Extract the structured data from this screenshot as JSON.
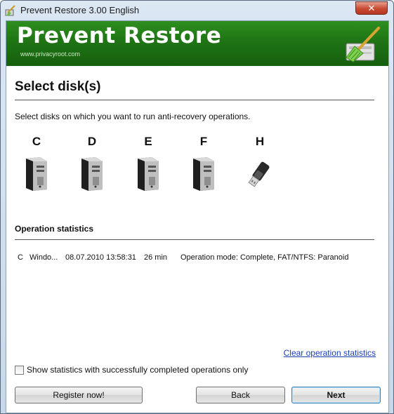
{
  "window": {
    "title": "Prevent Restore 3.00 English",
    "close_symbol": "✕"
  },
  "banner": {
    "title": "Prevent Restore",
    "url": "www.privacyroot.com"
  },
  "page": {
    "heading": "Select disk(s)",
    "description": "Select disks on which you want to run anti-recovery operations."
  },
  "disks": [
    {
      "letter": "C",
      "icon": "computer-tower-icon"
    },
    {
      "letter": "D",
      "icon": "computer-tower-icon"
    },
    {
      "letter": "E",
      "icon": "computer-tower-icon"
    },
    {
      "letter": "F",
      "icon": "computer-tower-icon"
    },
    {
      "letter": "H",
      "icon": "usb-drive-icon"
    }
  ],
  "statistics": {
    "label": "Operation statistics",
    "rows": [
      {
        "disk": "C",
        "name": "Windo...",
        "date": "08.07.2010 13:58:31",
        "duration": "26 min",
        "mode": "Operation mode: Complete, FAT/NTFS: Paranoid"
      }
    ],
    "clear_link": "Clear operation statistics",
    "checkbox_label": "Show statistics with successfully completed operations only",
    "checkbox_checked": false
  },
  "buttons": {
    "register": "Register now!",
    "back": "Back",
    "next": "Next"
  },
  "colors": {
    "banner_green": "#1f7415",
    "link_blue": "#1a3fb5",
    "close_red": "#c84a33"
  }
}
